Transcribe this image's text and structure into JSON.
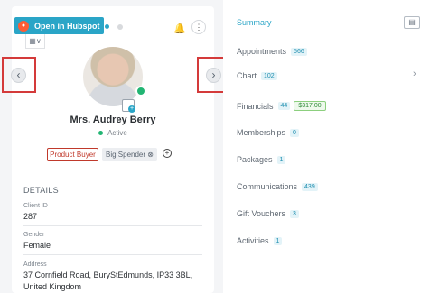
{
  "header": {
    "open_hubspot_label": "Open in Hubspot",
    "view_toggle": "▦∨",
    "bell_icon": "🔔",
    "kebab_icon": "⋮"
  },
  "client": {
    "name": "Mrs. Audrey Berry",
    "status": "Active",
    "tags": [
      "Product Buyer",
      "Big Spender ⊗"
    ],
    "add_tag_icon": "+"
  },
  "navigation": {
    "prev_icon": "‹",
    "next_icon": "›"
  },
  "details": {
    "title": "DETAILS",
    "client_id_label": "Client ID",
    "client_id_value": "287",
    "gender_label": "Gender",
    "gender_value": "Female",
    "address_label": "Address",
    "address_line1": "37 Cornfield Road, BuryStEdmunds, IP33 3BL,",
    "address_line2": "United Kingdom"
  },
  "menu": {
    "summary": "Summary",
    "appointments": "Appointments",
    "appointments_count": "566",
    "chart": "Chart",
    "chart_count": "102",
    "financials": "Financials",
    "financials_count": "44",
    "financials_amount": "$317.00",
    "memberships": "Memberships",
    "memberships_count": "0",
    "packages": "Packages",
    "packages_count": "1",
    "communications": "Communications",
    "communications_count": "439",
    "gift_vouchers": "Gift Vouchers",
    "gift_vouchers_count": "3",
    "activities": "Activities",
    "activities_count": "1",
    "summary_action_icon": "▤",
    "chevron": "›"
  },
  "colors": {
    "accent": "#2aa5c7",
    "danger": "#d43a3a",
    "success": "#22b573"
  }
}
